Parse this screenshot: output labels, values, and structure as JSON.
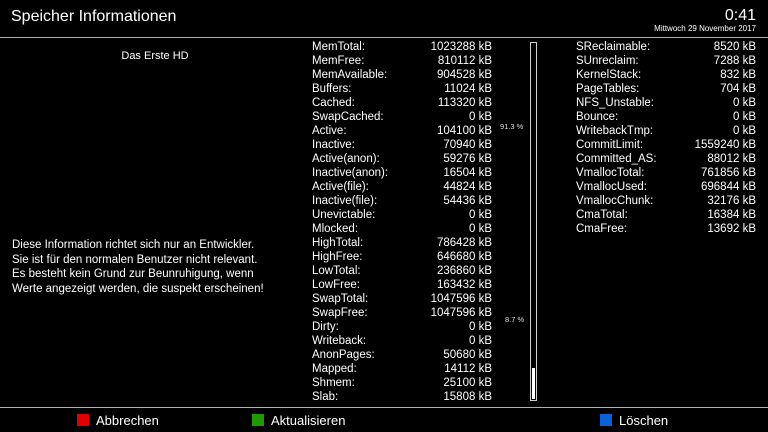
{
  "header": {
    "title": "Speicher Informationen",
    "time": "0:41",
    "date": "Mittwoch 29 November 2017"
  },
  "left": {
    "channel": "Das Erste HD",
    "info_lines": [
      "Diese Information richtet sich nur an Entwickler.",
      "Sie ist für den normalen Benutzer nicht relevant.",
      "Es besteht kein Grund zur Beunruhigung, wenn",
      "Werte angezeigt werden, die suspekt erscheinen!"
    ]
  },
  "memory_col1": [
    {
      "key": "MemTotal:",
      "value": "1023288 kB"
    },
    {
      "key": "MemFree:",
      "value": "810112 kB"
    },
    {
      "key": "MemAvailable:",
      "value": "904528 kB"
    },
    {
      "key": "Buffers:",
      "value": "11024 kB"
    },
    {
      "key": "Cached:",
      "value": "113320 kB"
    },
    {
      "key": "SwapCached:",
      "value": "0 kB"
    },
    {
      "key": "Active:",
      "value": "104100 kB"
    },
    {
      "key": "Inactive:",
      "value": "70940 kB"
    },
    {
      "key": "Active(anon):",
      "value": "59276 kB"
    },
    {
      "key": "Inactive(anon):",
      "value": "16504 kB"
    },
    {
      "key": "Active(file):",
      "value": "44824 kB"
    },
    {
      "key": "Inactive(file):",
      "value": "54436 kB"
    },
    {
      "key": "Unevictable:",
      "value": "0 kB"
    },
    {
      "key": "Mlocked:",
      "value": "0 kB"
    },
    {
      "key": "HighTotal:",
      "value": "786428 kB"
    },
    {
      "key": "HighFree:",
      "value": "646680 kB"
    },
    {
      "key": "LowTotal:",
      "value": "236860 kB"
    },
    {
      "key": "LowFree:",
      "value": "163432 kB"
    },
    {
      "key": "SwapTotal:",
      "value": "1047596 kB"
    },
    {
      "key": "SwapFree:",
      "value": "1047596 kB"
    },
    {
      "key": "Dirty:",
      "value": "0 kB"
    },
    {
      "key": "Writeback:",
      "value": "0 kB"
    },
    {
      "key": "AnonPages:",
      "value": "50680 kB"
    },
    {
      "key": "Mapped:",
      "value": "14112 kB"
    },
    {
      "key": "Shmem:",
      "value": "25100 kB"
    },
    {
      "key": "Slab:",
      "value": "15808 kB"
    }
  ],
  "memory_col2": [
    {
      "key": "SReclaimable:",
      "value": "8520 kB"
    },
    {
      "key": "SUnreclaim:",
      "value": "7288 kB"
    },
    {
      "key": "KernelStack:",
      "value": "832 kB"
    },
    {
      "key": "PageTables:",
      "value": "704 kB"
    },
    {
      "key": "NFS_Unstable:",
      "value": "0 kB"
    },
    {
      "key": "Bounce:",
      "value": "0 kB"
    },
    {
      "key": "WritebackTmp:",
      "value": "0 kB"
    },
    {
      "key": "CommitLimit:",
      "value": "1559240 kB"
    },
    {
      "key": "Committed_AS:",
      "value": "88012 kB"
    },
    {
      "key": "VmallocTotal:",
      "value": "761856 kB"
    },
    {
      "key": "VmallocUsed:",
      "value": "696844 kB"
    },
    {
      "key": "VmallocChunk:",
      "value": "32176 kB"
    },
    {
      "key": "CmaTotal:",
      "value": "16384 kB"
    },
    {
      "key": "CmaFree:",
      "value": "13692 kB"
    }
  ],
  "usage_bar": {
    "free_label": "91.3 %",
    "used_label": "8.7 %",
    "used_fraction": 0.087
  },
  "footer": {
    "red_label": "Abbrechen",
    "green_label": "Aktualisieren",
    "blue_label": "Löschen",
    "colors": {
      "red": "#e00000",
      "green": "#1f9a00",
      "blue": "#0a62d6"
    }
  }
}
